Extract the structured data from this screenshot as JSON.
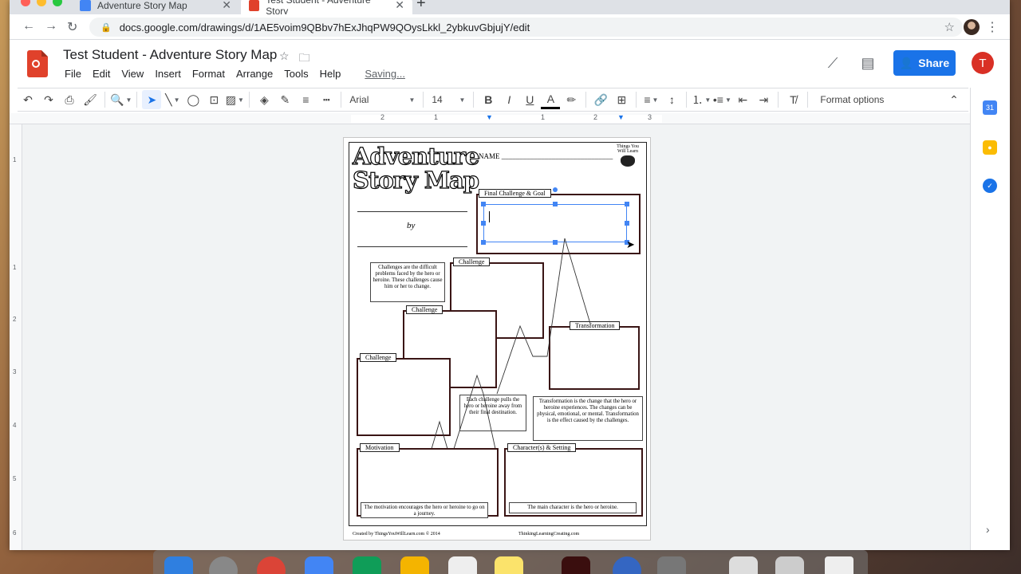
{
  "browser": {
    "tabs": [
      {
        "title": "Adventure Story Map",
        "active": false
      },
      {
        "title": "Test Student - Adventure Story",
        "active": true
      }
    ],
    "url": "docs.google.com/drawings/d/1AE5voim9QBbv7hExJhqPW9QOysLkkl_2ybkuvGbjujY/edit"
  },
  "doc": {
    "title": "Test Student - Adventure Story Map",
    "menu": [
      "File",
      "Edit",
      "View",
      "Insert",
      "Format",
      "Arrange",
      "Tools",
      "Help"
    ],
    "status": "Saving...",
    "share_label": "Share",
    "avatar_letter": "T"
  },
  "toolbar": {
    "font": "Arial",
    "size": "14",
    "format_options": "Format options"
  },
  "ruler": {
    "h_labels": [
      "2",
      "1",
      "1",
      "2",
      "3"
    ],
    "v_labels": [
      "1",
      "1",
      "2",
      "3",
      "4",
      "5",
      "6"
    ]
  },
  "page": {
    "title_line1": "Adventure",
    "title_line2": "Story Map",
    "name_label": "NAME _______________________________",
    "logo_text": "Things You Will Learn",
    "by": "by",
    "final_challenge": "Final Challenge & Goal",
    "challenge": "Challenge",
    "transformation": "Transformation",
    "motivation": "Motivation",
    "characters": "Character(s) & Setting",
    "note_challenges": "Challenges are the difficult problems faced by the hero or heroine. These challenges cause him or her to change.",
    "note_pulls": "Each challenge pulls the hero or heroine away from their final destination.",
    "note_transformation": "Transformation is the change that the hero or heroine experiences. The changes can be physical, emotional, or mental. Transformation is the effect caused by the challenges.",
    "note_motivation": "The motivation encourages the hero or heroine to go on a journey.",
    "note_character": "The main character is the hero or heroine.",
    "footer_left": "Created by ThingsYouWillLearn.com © 2014",
    "footer_right": "ThinkingLearningCreating.com"
  },
  "colors": {
    "accent": "#1a73e8",
    "brand_red": "#e0412b",
    "selection": "#4285f4"
  }
}
